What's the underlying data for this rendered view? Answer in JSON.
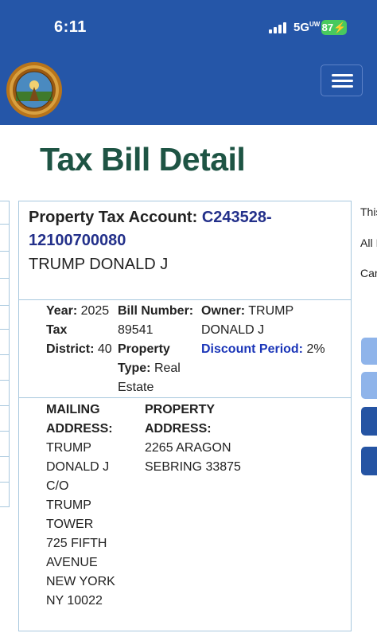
{
  "status_bar": {
    "time": "6:11",
    "network": "5G",
    "network_sup": "UW",
    "battery": "87"
  },
  "header": {
    "seal_alt": "Polk County Tax Collector seal",
    "menu_icon": "hamburger-menu-icon"
  },
  "page": {
    "title": "Tax Bill Detail"
  },
  "account": {
    "label": "Property Tax Account:",
    "number": "C243528-12100700080",
    "owner_line": "TRUMP DONALD J"
  },
  "details": {
    "year_label": "Year:",
    "year_value": "2025",
    "tax_label": "Tax",
    "district_label": "District:",
    "district_value": "40",
    "bill_number_label": "Bill Number:",
    "bill_number_value": "89541",
    "property_type_label_1": "Property",
    "property_type_label_2": "Type:",
    "property_type_value_1": "Real",
    "property_type_value_2": "Estate",
    "owner_label": "Owner:",
    "owner_value_1": "TRUMP",
    "owner_value_2": "DONALD J",
    "discount_label": "Discount Period:",
    "discount_value": "2%"
  },
  "mailing": {
    "label_1": "MAILING",
    "label_2": "ADDRESS:",
    "lines": [
      "TRUMP",
      "DONALD J",
      "C/O",
      "TRUMP",
      "TOWER",
      "725 FIFTH",
      "AVENUE",
      "NEW YORK",
      "NY 10022"
    ]
  },
  "property_address": {
    "label_1": "PROPERTY",
    "label_2": "ADDRESS:",
    "line_1": "2265 ARAGON",
    "line_2": "SEBRING 33875"
  },
  "right_panel": {
    "text_1": "This",
    "text_2": "All I",
    "text_3": "Car"
  },
  "colors": {
    "header_bg": "#2556a8",
    "title_green": "#1e5444",
    "account_blue": "#23308a",
    "discount_blue": "#1a35b8",
    "border": "#a8c8de"
  }
}
